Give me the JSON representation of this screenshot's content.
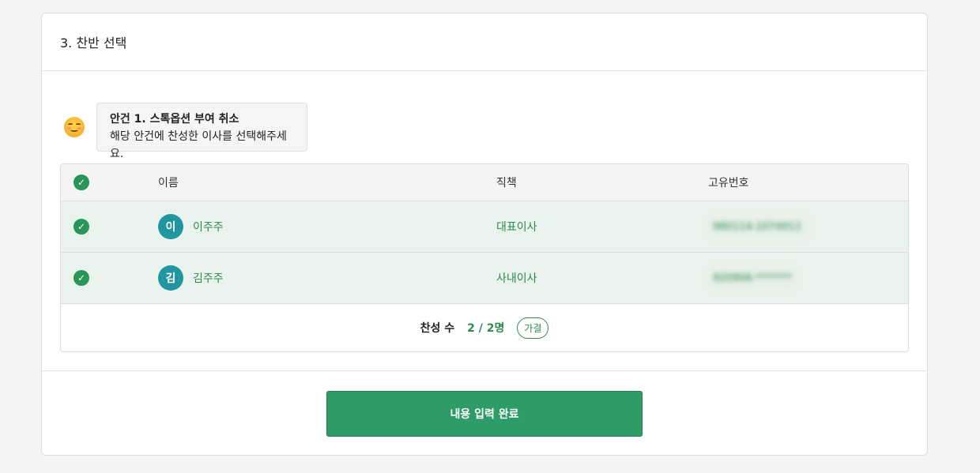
{
  "section": {
    "title": "3. 찬반 선택"
  },
  "agenda": {
    "title": "안건 1. 스톡옵션 부여 취소",
    "instruction": "해당 안건에 찬성한 이사를 선택해주세요.",
    "emoji": "smiling-face-icon"
  },
  "table": {
    "columns": [
      "이름",
      "직책",
      "고유번호"
    ],
    "rows": [
      {
        "avatar": "이",
        "name": "이주주",
        "position": "대표이사",
        "id": "980114-1074911",
        "selected": true
      },
      {
        "avatar": "김",
        "name": "김주주",
        "position": "사내이사",
        "id": "920906-*******",
        "selected": true
      }
    ]
  },
  "summary": {
    "label": "찬성 수",
    "count": "2 / 2명",
    "result": "가결"
  },
  "submit": {
    "label": "내용 입력 완료"
  },
  "colors": {
    "accent": "#2e9c66",
    "avatar": "#2196a0",
    "selected_row": "#e9f2ec"
  }
}
